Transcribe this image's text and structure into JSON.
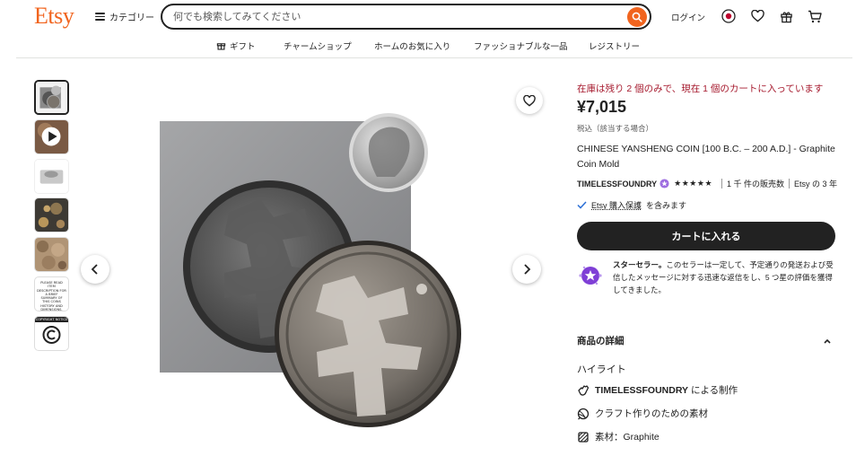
{
  "header": {
    "logo": "Etsy",
    "categories_label": "カテゴリー",
    "search_placeholder": "何でも検索してみてください",
    "login_label": "ログイン"
  },
  "nav": {
    "items": [
      "ギフト",
      "チャームショップ",
      "ホームのお気に入り",
      "ファッショナブルな一品",
      "レジストリー"
    ]
  },
  "gallery": {
    "thumb_text": "PLEASE READ ITEM DESCRIPTION FOR A BRIEF SUMMARY OF THIS COINS HISTORY AND DIMENSIONS.",
    "thumb_copyright": "COPYRIGHT NOTICE"
  },
  "product": {
    "stock_notice": "在庫は残り 2 個のみで、現在 1 個のカートに入っています",
    "price": "¥7,015",
    "tax_note": "税込（該当する場合）",
    "title": "CHINESE YANSHENG COIN [100 B.C. – 200 A.D.] - Graphite Coin Mold",
    "shop_name": "TIMELESSFOUNDRY",
    "stars": "★★★★★",
    "sales": "1 千 件の販売数",
    "shop_age": "Etsy の 3 年",
    "purchase_protection_link": "Etsy 購入保護",
    "purchase_protection_suffix": "を含みます",
    "add_to_cart": "カートに入れる",
    "star_seller_title": "スターセラー。",
    "star_seller_text": "このセラーは一定して、予定通りの発送および受信したメッセージに対する迅速な返信をし、5 つ星の評価を獲得してきました。",
    "details_heading": "商品の詳細",
    "highlights_heading": "ハイライト",
    "maker_name": "TIMELESSFOUNDRY",
    "maker_suffix": "による制作",
    "craft_material": "クラフト作りのための素材",
    "material": "素材：Graphite"
  },
  "colors": {
    "brand_orange": "#f1641e",
    "stock_red": "#a61a2e",
    "star_seller_purple": "#7f3fd6"
  }
}
